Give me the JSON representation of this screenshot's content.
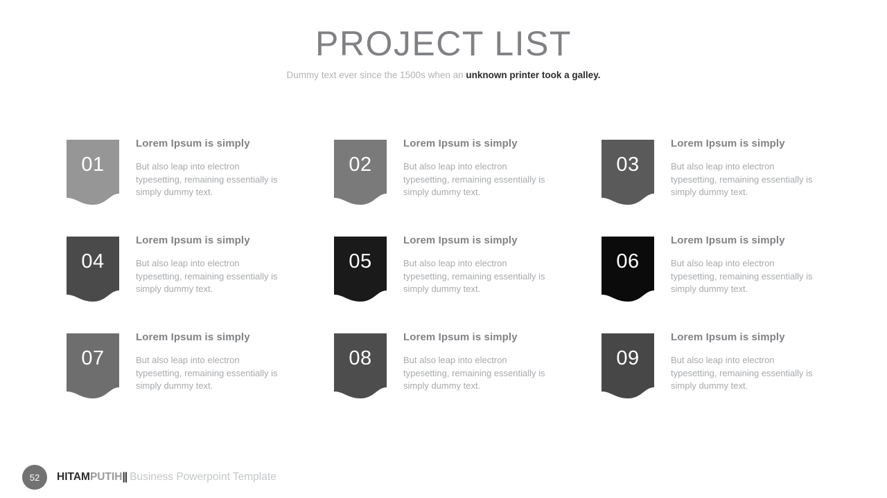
{
  "header": {
    "title": "PROJECT LIST",
    "subtitle_normal": "Dummy text ever since the 1500s when an ",
    "subtitle_bold": "unknown printer took a galley."
  },
  "colors": {
    "title": "#808184",
    "subtitle": "#b3b3b3",
    "item_title": "#808285",
    "item_desc": "#a7a9ac",
    "page_circle": "#727272"
  },
  "items": [
    {
      "number": "01",
      "title": "Lorem Ipsum is simply",
      "description": "But also leap into electron typesetting, remaining essentially is simply dummy text.",
      "color": "#969696"
    },
    {
      "number": "02",
      "title": "Lorem Ipsum is simply",
      "description": "But also leap into electron typesetting, remaining essentially is simply dummy text.",
      "color": "#7a7a7a"
    },
    {
      "number": "03",
      "title": "Lorem Ipsum is simply",
      "description": "But also leap into electron typesetting, remaining essentially is simply dummy text.",
      "color": "#5a5a5a"
    },
    {
      "number": "04",
      "title": "Lorem Ipsum is simply",
      "description": "But also leap into electron typesetting, remaining essentially is simply dummy text.",
      "color": "#4a4a4a"
    },
    {
      "number": "05",
      "title": "Lorem Ipsum is simply",
      "description": "But also leap into electron typesetting, remaining essentially is simply dummy text.",
      "color": "#1a1a1a"
    },
    {
      "number": "06",
      "title": "Lorem Ipsum is simply",
      "description": "But also leap into electron typesetting, remaining essentially is simply dummy text.",
      "color": "#0b0b0b"
    },
    {
      "number": "07",
      "title": "Lorem Ipsum is simply",
      "description": "But also leap into electron typesetting, remaining essentially is simply dummy text.",
      "color": "#6e6e6e"
    },
    {
      "number": "08",
      "title": "Lorem Ipsum is simply",
      "description": "But also leap into electron typesetting, remaining essentially is simply dummy text.",
      "color": "#4d4d4d"
    },
    {
      "number": "09",
      "title": "Lorem Ipsum is simply",
      "description": "But also leap into electron typesetting, remaining essentially is simply dummy text.",
      "color": "#474747"
    }
  ],
  "footer": {
    "page_number": "52",
    "brand_part1": "HITAM",
    "brand_part2": "PUTIH",
    "brand_separator": "||",
    "tagline": "Business Powerpoint Template"
  }
}
